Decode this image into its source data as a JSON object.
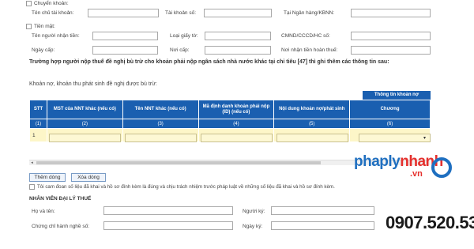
{
  "payment": {
    "transfer_label": "Chuyển khoản:",
    "account_holder_label": "Tên chủ tài khoản:",
    "account_number_label": "Tài khoản số:",
    "bank_label": "Tại Ngân hàng/KBNN:",
    "cash_label": "Tiền mặt:",
    "recipient_label": "Tên người nhận tiền:",
    "id_type_label": "Loại giấy tờ:",
    "id_number_label": "CMND/CCCD/HC số:",
    "issue_date_label": "Ngày cấp:",
    "issue_place_label": "Nơi cấp:",
    "refund_place_label": "Nơi nhận tiền hoàn thuế:"
  },
  "notice": "Trường hợp người nộp thuế đề nghị bù trừ cho khoản phải nộp ngân sách nhà nước khác tại chỉ tiêu [47] thì ghi thêm các thông tin sau:",
  "debt_label": "Khoản nợ, khoản thu phát sinh đề nghị được bù trừ:",
  "table": {
    "top_right_header": "Thông tin khoản nợ",
    "headers": [
      "STT",
      "MST của NNT khác (nếu có)",
      "Tên NNT khác (nếu có)",
      "Mã định danh khoản phải nộp (ID) (nếu có)",
      "Nội dung khoản nợ/phát sinh",
      "Chương"
    ],
    "indices": [
      "(1)",
      "(2)",
      "(3)",
      "(4)",
      "(5)",
      "(6)"
    ],
    "row_stt": "1"
  },
  "buttons": {
    "add": "Thêm dòng",
    "delete": "Xóa dòng"
  },
  "commit_text": "Tôi cam đoan số liệu đã khai và hồ sơ đính kèm là đúng và chịu trách nhiệm trước pháp luật về những số liệu đã khai và hồ sơ đính kèm.",
  "agent": {
    "section_title": "NHÂN VIÊN ĐẠI LÝ THUẾ",
    "name_label": "Họ và tên:",
    "signer_label": "Người ký:",
    "cert_label": "Chứng chỉ hành nghề số:",
    "sign_date_label": "Ngày ký:"
  },
  "brand": {
    "part1": "phaply",
    "part2": "nhanh",
    "suffix": ".vn",
    "phone": "0907.520.537",
    "accent": "#1f6fc0",
    "phone_color": "#1a1a1a"
  }
}
